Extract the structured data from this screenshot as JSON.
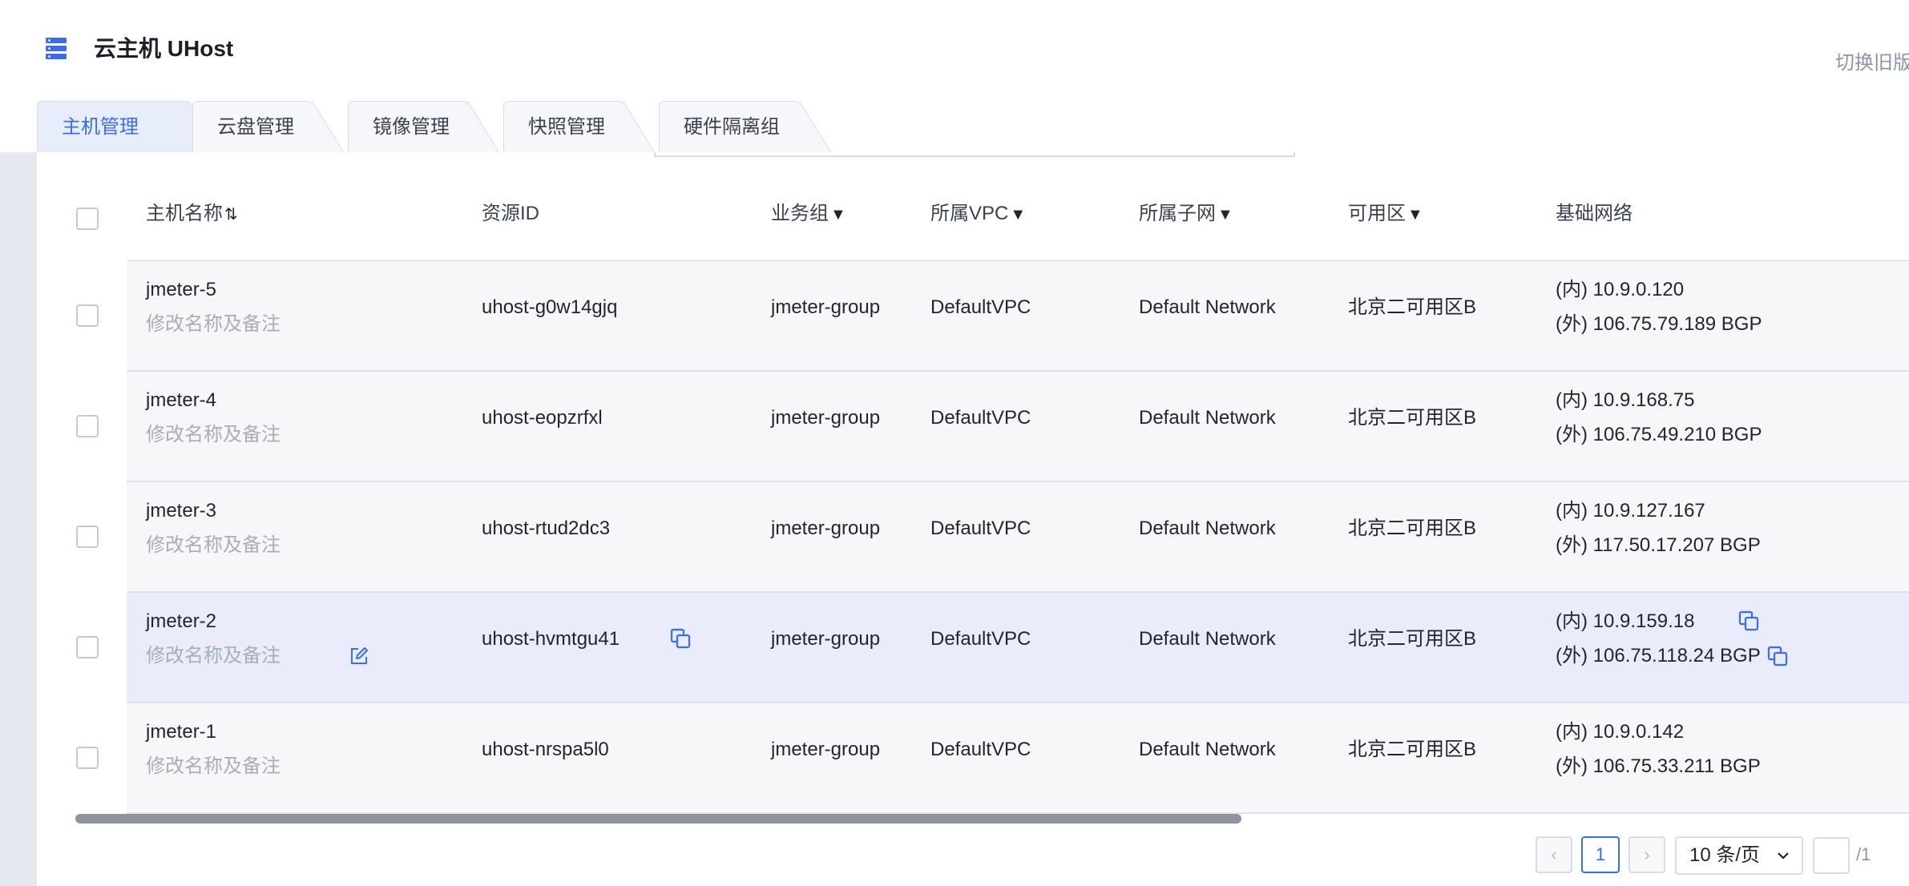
{
  "app": {
    "title": "云主机 UHost",
    "switch_old": "切换旧版"
  },
  "tabs": [
    {
      "label": "主机管理",
      "active": true
    },
    {
      "label": "云盘管理",
      "active": false
    },
    {
      "label": "镜像管理",
      "active": false
    },
    {
      "label": "快照管理",
      "active": false
    },
    {
      "label": "硬件隔离组",
      "active": false
    }
  ],
  "table": {
    "columns": {
      "name": "主机名称",
      "name_sort": "⇅",
      "resource_id": "资源ID",
      "group": "业务组",
      "vpc": "所属VPC",
      "subnet": "所属子网",
      "zone": "可用区",
      "network": "基础网络",
      "filter_icon": "▼"
    },
    "note_placeholder": "修改名称及备注",
    "rows": [
      {
        "name": "jmeter-5",
        "note": "修改名称及备注",
        "id": "uhost-g0w14gjq",
        "group": "jmeter-group",
        "vpc": "DefaultVPC",
        "subnet": "Default Network",
        "zone": "北京二可用区B",
        "ip_in": "(内) 10.9.0.120",
        "ip_out": "(外) 106.75.79.189 BGP"
      },
      {
        "name": "jmeter-4",
        "note": "修改名称及备注",
        "id": "uhost-eopzrfxl",
        "group": "jmeter-group",
        "vpc": "DefaultVPC",
        "subnet": "Default Network",
        "zone": "北京二可用区B",
        "ip_in": "(内) 10.9.168.75",
        "ip_out": "(外) 106.75.49.210 BGP"
      },
      {
        "name": "jmeter-3",
        "note": "修改名称及备注",
        "id": "uhost-rtud2dc3",
        "group": "jmeter-group",
        "vpc": "DefaultVPC",
        "subnet": "Default Network",
        "zone": "北京二可用区B",
        "ip_in": "(内) 10.9.127.167",
        "ip_out": "(外) 117.50.17.207 BGP"
      },
      {
        "name": "jmeter-2",
        "note": "修改名称及备注",
        "id": "uhost-hvmtgu41",
        "group": "jmeter-group",
        "vpc": "DefaultVPC",
        "subnet": "Default Network",
        "zone": "北京二可用区B",
        "ip_in": "(内) 10.9.159.18",
        "ip_out": "(外) 106.75.118.24 BGP"
      },
      {
        "name": "jmeter-1",
        "note": "修改名称及备注",
        "id": "uhost-nrspa5l0",
        "group": "jmeter-group",
        "vpc": "DefaultVPC",
        "subnet": "Default Network",
        "zone": "北京二可用区B",
        "ip_in": "(内) 10.9.0.142",
        "ip_out": "(外) 106.75.33.211 BGP"
      }
    ]
  },
  "pagination": {
    "prev": "‹",
    "next": "›",
    "current_page": "1",
    "page_size": "10 条/页",
    "total": "/1"
  },
  "colors": {
    "accent": "#3b6cf0",
    "hover_row": "#e9edfb"
  }
}
